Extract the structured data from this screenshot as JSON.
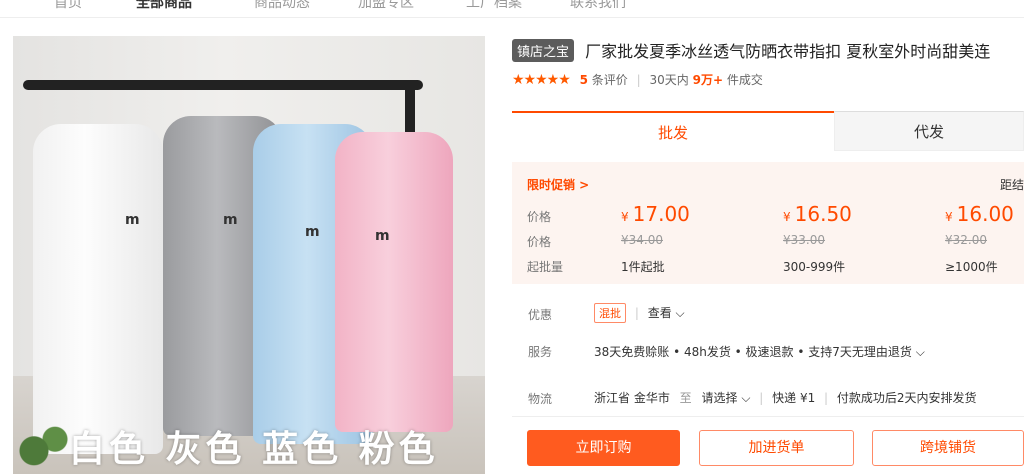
{
  "nav": {
    "items": [
      "首页",
      "全部商品",
      "商品动态",
      "加盟专区",
      "工厂档案",
      "联系我们"
    ]
  },
  "gallery": {
    "caption": "白色 灰色 蓝色 粉色",
    "logo_text": "m"
  },
  "product": {
    "shop_badge": "镇店之宝",
    "title": "厂家批发夏季冰丝透气防晒衣带指扣 夏秋室外时尚甜美连",
    "rating_count": "5",
    "rating_suffix": "条评价",
    "sales_prefix": "30天内",
    "sales_value": "9万+",
    "sales_suffix": "件成交"
  },
  "tabs": {
    "wholesale": "批发",
    "dropship": "代发"
  },
  "pricing": {
    "promo_label": "限时促销 >",
    "promo_right": "距结",
    "row_labels": {
      "price": "价格",
      "orig": "价格",
      "moq": "起批量"
    },
    "currency": "¥",
    "tiers": [
      {
        "now": "17.00",
        "old": "¥34.00",
        "qty": "1件起批"
      },
      {
        "now": "16.50",
        "old": "¥33.00",
        "qty": "300-999件"
      },
      {
        "now": "16.00",
        "old": "¥32.00",
        "qty": "≥1000件"
      }
    ]
  },
  "offers": {
    "label": "优惠",
    "tag": "混批",
    "more": "查看 ⌵"
  },
  "service": {
    "label": "服务",
    "text": "38天免费赊账 • 48h发货 • 极速退款 • 支持7天无理由退货 ⌵"
  },
  "logistics": {
    "label": "物流",
    "from": "浙江省 金华市",
    "to_label": "至",
    "to_value": "请选择 ⌵",
    "express": "快递 ¥1",
    "ship_note": "付款成功后2天内安排发货"
  },
  "actions": {
    "buy": "立即订购",
    "cart": "加进货单",
    "crossborder": "跨境铺货"
  },
  "colors": {
    "accent": "#ff4a00",
    "button": "#ff5b1f",
    "badge": "#5c5c5c"
  }
}
